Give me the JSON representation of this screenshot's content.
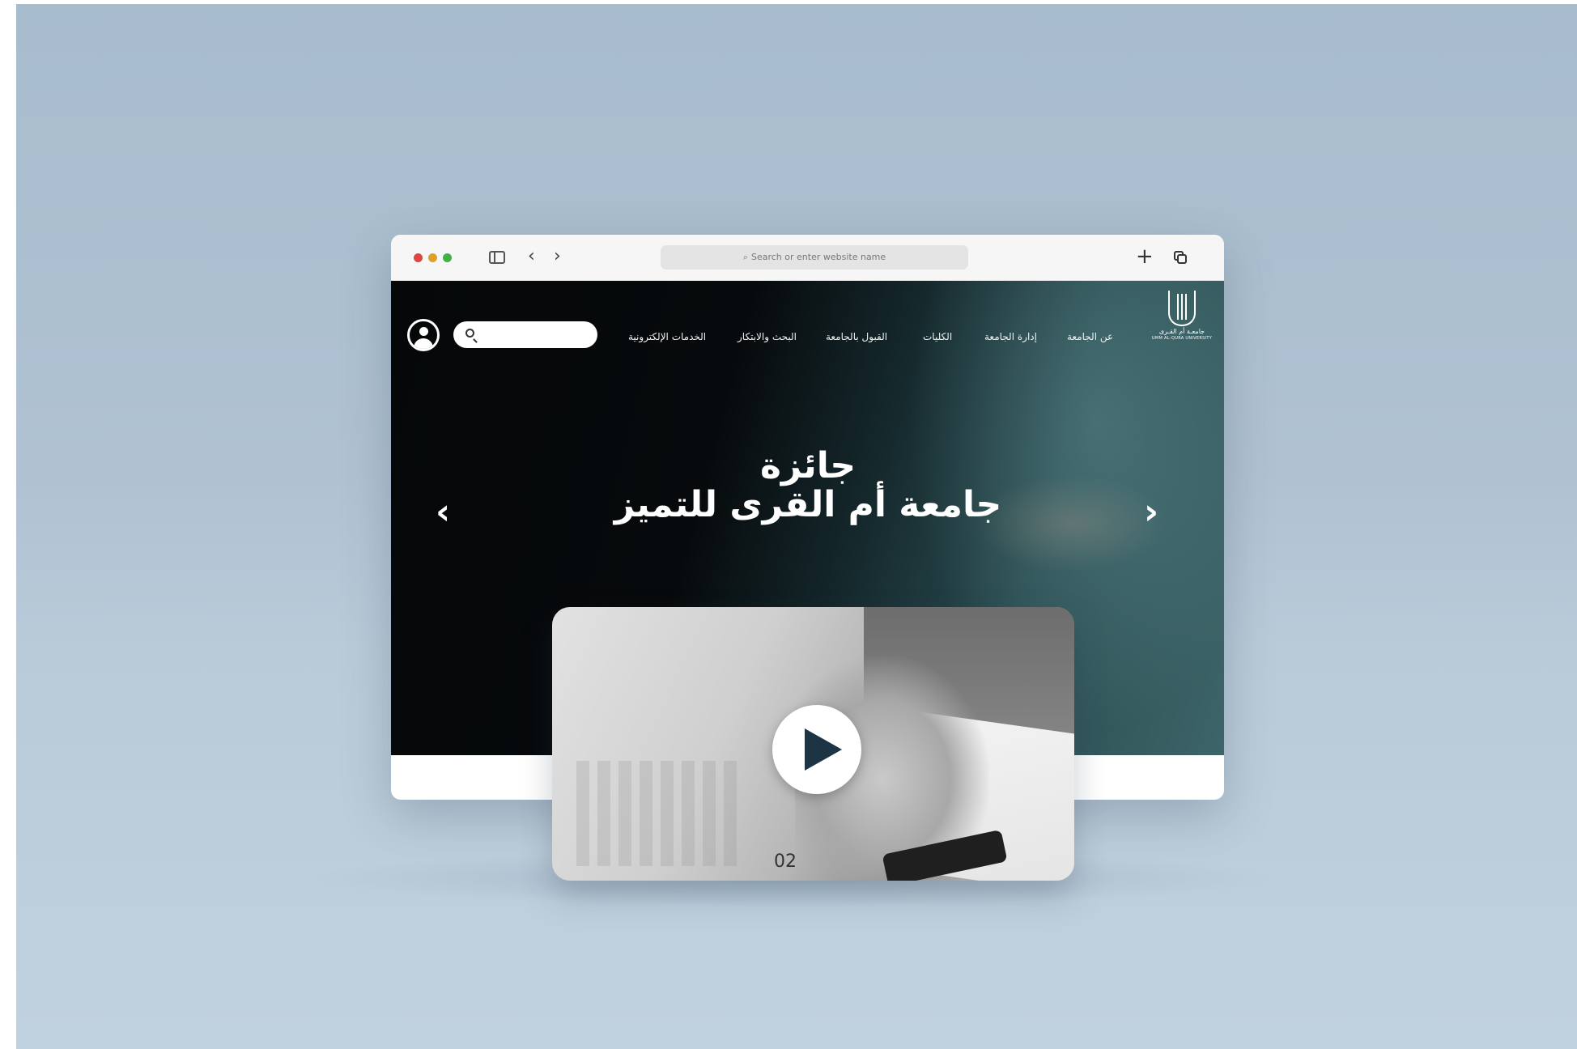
{
  "browser": {
    "address_placeholder": "Search or enter website name",
    "icons": [
      "sidebar-icon",
      "back-icon",
      "forward-icon",
      "search-icon",
      "plus-icon",
      "tabs-icon"
    ]
  },
  "site": {
    "logo_text": "جامعـة أم القـرى",
    "logo_subtext": "UMM AL-QURA UNIVERSITY",
    "nav": [
      {
        "label": "عن الجامعة"
      },
      {
        "label": "إدارة الجامعة"
      },
      {
        "label": "الكليات"
      },
      {
        "label": "القبول بالجامعة"
      },
      {
        "label": "البحث والابتكار"
      },
      {
        "label": "الخدمات الإلكترونية"
      }
    ],
    "search_placeholder": ""
  },
  "hero": {
    "title_line1": "جائزة",
    "title_line2": "جامعة أم القرى للتميز",
    "prev_glyph": "‹",
    "next_glyph": "›"
  },
  "video": {
    "frame_label": "02"
  },
  "colors": {
    "background": "#b0c2d2",
    "hero_dark": "#070a0c",
    "hero_teal": "#3d6468",
    "play_icon": "#1d3444"
  }
}
